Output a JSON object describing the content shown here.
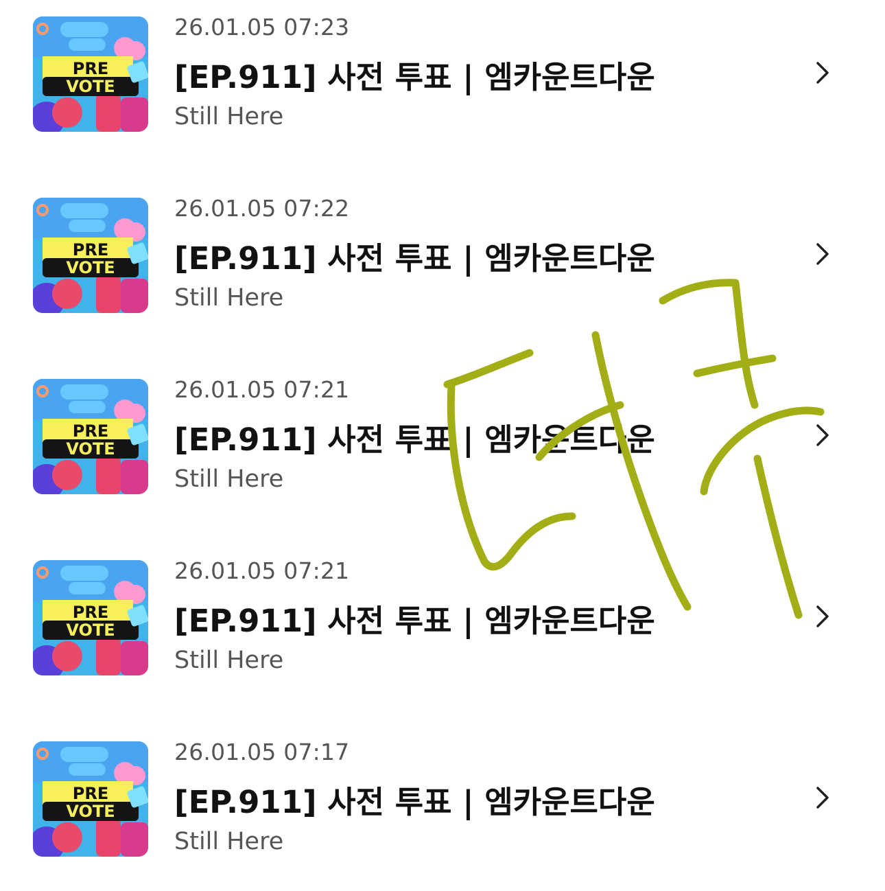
{
  "items": [
    {
      "timestamp": "26.01.05 07:23",
      "title": "[EP.911] 사전 투표 | 엠카운트다운",
      "subtitle": "Still Here",
      "thumb": {
        "line1": "PRE",
        "line2": "VOTE"
      }
    },
    {
      "timestamp": "26.01.05 07:22",
      "title": "[EP.911] 사전 투표 | 엠카운트다운",
      "subtitle": "Still Here",
      "thumb": {
        "line1": "PRE",
        "line2": "VOTE"
      }
    },
    {
      "timestamp": "26.01.05 07:21",
      "title": "[EP.911] 사전 투표 | 엠카운트다운",
      "subtitle": "Still Here",
      "thumb": {
        "line1": "PRE",
        "line2": "VOTE"
      }
    },
    {
      "timestamp": "26.01.05 07:21",
      "title": "[EP.911] 사전 투표 | 엠카운트다운",
      "subtitle": "Still Here",
      "thumb": {
        "line1": "PRE",
        "line2": "VOTE"
      }
    },
    {
      "timestamp": "26.01.05 07:17",
      "title": "[EP.911] 사전 투표 | 엠카운트다운",
      "subtitle": "Still Here",
      "thumb": {
        "line1": "PRE",
        "line2": "VOTE"
      }
    }
  ],
  "handwriting": {
    "text": "더쿠",
    "color": "#a3ad15"
  },
  "icons": {
    "chevron": "chevron-right-icon"
  }
}
